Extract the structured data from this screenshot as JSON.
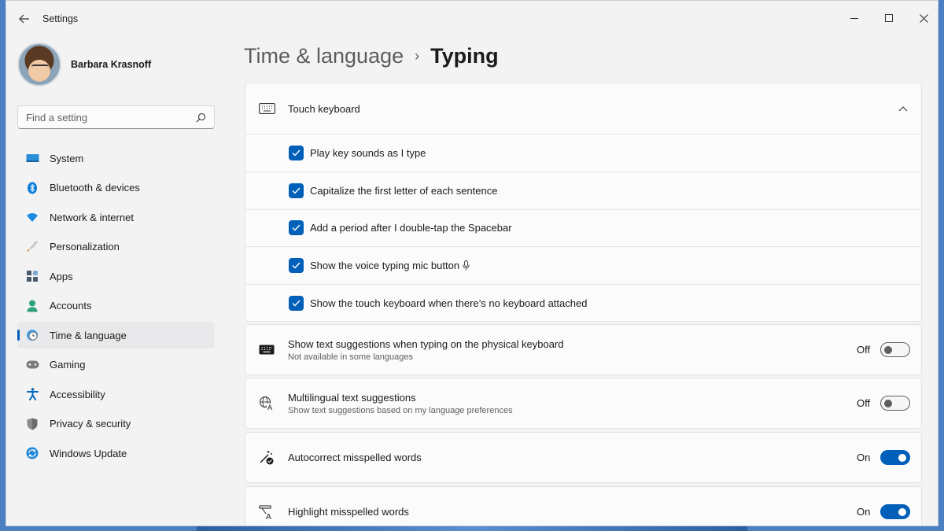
{
  "window": {
    "title": "Settings"
  },
  "profile": {
    "name": "Barbara Krasnoff"
  },
  "search": {
    "placeholder": "Find a setting"
  },
  "nav": [
    {
      "label": "System",
      "icon": "monitor-icon",
      "color": "#0078d4"
    },
    {
      "label": "Bluetooth & devices",
      "icon": "bluetooth-icon",
      "color": "#0078d4"
    },
    {
      "label": "Network & internet",
      "icon": "wifi-icon",
      "color": "#0078d4"
    },
    {
      "label": "Personalization",
      "icon": "brush-icon",
      "color": "#e08a3c"
    },
    {
      "label": "Apps",
      "icon": "apps-icon",
      "color": "#4a5a6a"
    },
    {
      "label": "Accounts",
      "icon": "person-icon",
      "color": "#2ea37a"
    },
    {
      "label": "Time & language",
      "icon": "clock-globe-icon",
      "color": "#0078d4",
      "active": true
    },
    {
      "label": "Gaming",
      "icon": "gamepad-icon",
      "color": "#6b6b6b"
    },
    {
      "label": "Accessibility",
      "icon": "accessibility-icon",
      "color": "#0067c0"
    },
    {
      "label": "Privacy & security",
      "icon": "shield-icon",
      "color": "#6b6b6b"
    },
    {
      "label": "Windows Update",
      "icon": "update-icon",
      "color": "#0078d4"
    }
  ],
  "breadcrumb": {
    "parent": "Time & language",
    "separator": "›",
    "current": "Typing"
  },
  "touch_keyboard": {
    "title": "Touch keyboard",
    "expanded": true,
    "options": [
      {
        "label": "Play key sounds as I type",
        "checked": true
      },
      {
        "label": "Capitalize the first letter of each sentence",
        "checked": true
      },
      {
        "label": "Add a period after I double-tap the Spacebar",
        "checked": true
      },
      {
        "label": "Show the voice typing mic button",
        "checked": true
      },
      {
        "label": "Show the touch keyboard when there’s no keyboard attached",
        "checked": true
      }
    ]
  },
  "settings": [
    {
      "title": "Show text suggestions when typing on the physical keyboard",
      "subtitle": "Not available in some languages",
      "state": "Off",
      "on": false,
      "icon": "keyboard-icon"
    },
    {
      "title": "Multilingual text suggestions",
      "subtitle": "Show text suggestions based on my language preferences",
      "state": "Off",
      "on": false,
      "icon": "multilingual-icon"
    },
    {
      "title": "Autocorrect misspelled words",
      "subtitle": "",
      "state": "On",
      "on": true,
      "icon": "autocorrect-icon"
    },
    {
      "title": "Highlight misspelled words",
      "subtitle": "",
      "state": "On",
      "on": true,
      "icon": "highlight-spelling-icon"
    }
  ],
  "colors": {
    "accent": "#005fb8",
    "window_bg": "#f3f3f3",
    "card_bg": "#fbfbfb"
  }
}
